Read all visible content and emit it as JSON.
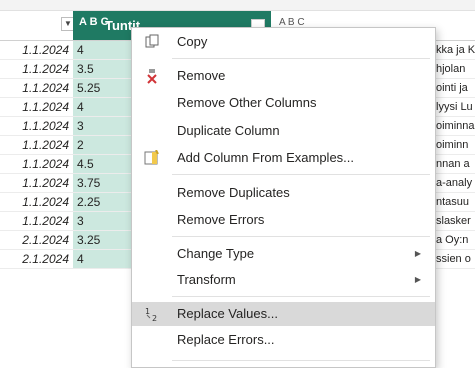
{
  "column_header": {
    "type_icon": "A B C",
    "selected_name": "Tuntit",
    "next_type_icon": "A B C"
  },
  "rows": [
    {
      "date": "1.1.2024",
      "hours": "4",
      "text": "kka ja K"
    },
    {
      "date": "1.1.2024",
      "hours": "3.5",
      "text": "hjolan"
    },
    {
      "date": "1.1.2024",
      "hours": "5.25",
      "text": "ointi ja"
    },
    {
      "date": "1.1.2024",
      "hours": "4",
      "text": "lyysi Lu"
    },
    {
      "date": "1.1.2024",
      "hours": "3",
      "text": "oiminna"
    },
    {
      "date": "1.1.2024",
      "hours": "2",
      "text": "oiminn"
    },
    {
      "date": "1.1.2024",
      "hours": "4.5",
      "text": "nnan a"
    },
    {
      "date": "1.1.2024",
      "hours": "3.75",
      "text": "a-analy"
    },
    {
      "date": "1.1.2024",
      "hours": "2.25",
      "text": "ntasuu"
    },
    {
      "date": "1.1.2024",
      "hours": "3",
      "text": "slasker"
    },
    {
      "date": "2.1.2024",
      "hours": "3.25",
      "text": "a Oy:n"
    },
    {
      "date": "2.1.2024",
      "hours": "4",
      "text": "ssien o"
    }
  ],
  "context_menu": {
    "items": [
      {
        "label": "Copy",
        "icon": "copy-icon"
      },
      {
        "label": "Remove",
        "icon": "remove-icon"
      },
      {
        "label": "Remove Other Columns"
      },
      {
        "label": "Duplicate Column"
      },
      {
        "label": "Add Column From Examples...",
        "icon": "add-column-examples-icon"
      },
      {
        "label": "Remove Duplicates"
      },
      {
        "label": "Remove Errors"
      },
      {
        "label": "Change Type",
        "submenu": true
      },
      {
        "label": "Transform",
        "submenu": true
      },
      {
        "label": "Replace Values...",
        "icon": "replace-values-icon",
        "highlighted": true
      },
      {
        "label": "Replace Errors..."
      }
    ]
  },
  "colors": {
    "selected_header": "#1f7a63",
    "selected_column_cells": "#cce8df",
    "menu_highlight": "#d9d9d9"
  }
}
